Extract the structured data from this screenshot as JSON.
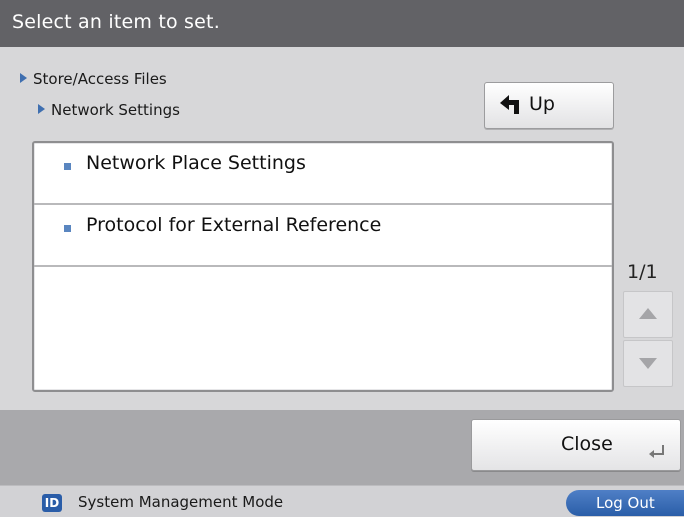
{
  "header": {
    "title": "Select an item to set."
  },
  "breadcrumb": {
    "level1": "Store/Access Files",
    "level2": "Network Settings"
  },
  "toolbar": {
    "up_label": "Up",
    "up_icon": "up-arrow-icon"
  },
  "list": {
    "items": [
      {
        "label": "Network Place Settings"
      },
      {
        "label": "Protocol for External Reference"
      }
    ]
  },
  "pager": {
    "page": "1/1"
  },
  "footer": {
    "close_label": "Close"
  },
  "status": {
    "mode_badge": "ID",
    "mode_text": "System Management Mode",
    "logout_label": "Log Out"
  },
  "colors": {
    "title_bar": "#626266",
    "accent_blue": "#2a5da8",
    "bullet_blue": "#5a86c0",
    "panel_gray": "#d7d7d9"
  }
}
